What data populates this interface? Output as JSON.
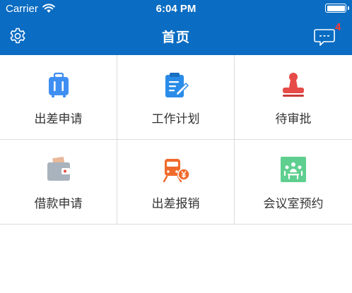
{
  "status_bar": {
    "carrier": "Carrier",
    "time": "6:04 PM"
  },
  "nav": {
    "title": "首页",
    "badge_count": "4"
  },
  "grid": {
    "items": [
      {
        "label": "出差申请",
        "icon": "luggage-icon",
        "color": "#3f8ff3"
      },
      {
        "label": "工作计划",
        "icon": "clipboard-edit-icon",
        "color": "#2a8ce8"
      },
      {
        "label": "待审批",
        "icon": "stamp-icon",
        "color": "#e64b47"
      },
      {
        "label": "借款申请",
        "icon": "wallet-icon",
        "color": "#a9b3bd"
      },
      {
        "label": "出差报销",
        "icon": "train-yen-icon",
        "color": "#f06a2b"
      },
      {
        "label": "会议室预约",
        "icon": "meeting-room-icon",
        "color": "#5fcf8f"
      }
    ]
  },
  "colors": {
    "header": "#0a6cc2",
    "badge": "#ff3b30"
  }
}
